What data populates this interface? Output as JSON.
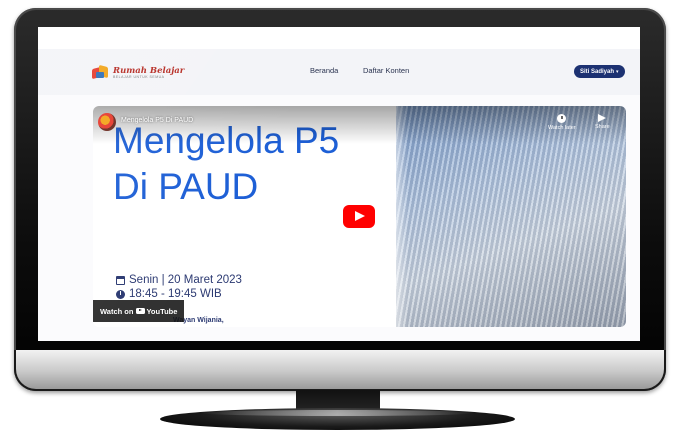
{
  "navbar": {
    "logo_text": "Rumah Belajar",
    "logo_tagline": "BELAJAR UNTUK SEMUA",
    "links": [
      "Beranda",
      "Daftar Konten"
    ],
    "user_button_label": "Siti Sadiyah",
    "user_button_icon": "chevron-down-icon",
    "user_button_color": "#1c3172"
  },
  "video": {
    "youtube_title": "Mengelola P5 Di PAUD",
    "controls": {
      "watch_later_label": "Watch later",
      "share_label": "Share"
    },
    "thumbnail": {
      "title_line_1": "Mengelola P5",
      "title_line_2": "Di PAUD",
      "title_color": "#1d5fd6",
      "date_text": "Senin | 20 Maret 2023",
      "time_text": "18:45 - 19:45 WIB",
      "presenter_partial": "Wayan Wijania,"
    },
    "watch_on_label": "Watch on",
    "youtube_logo_text": "YouTube",
    "play_button_color": "#ff0000"
  }
}
